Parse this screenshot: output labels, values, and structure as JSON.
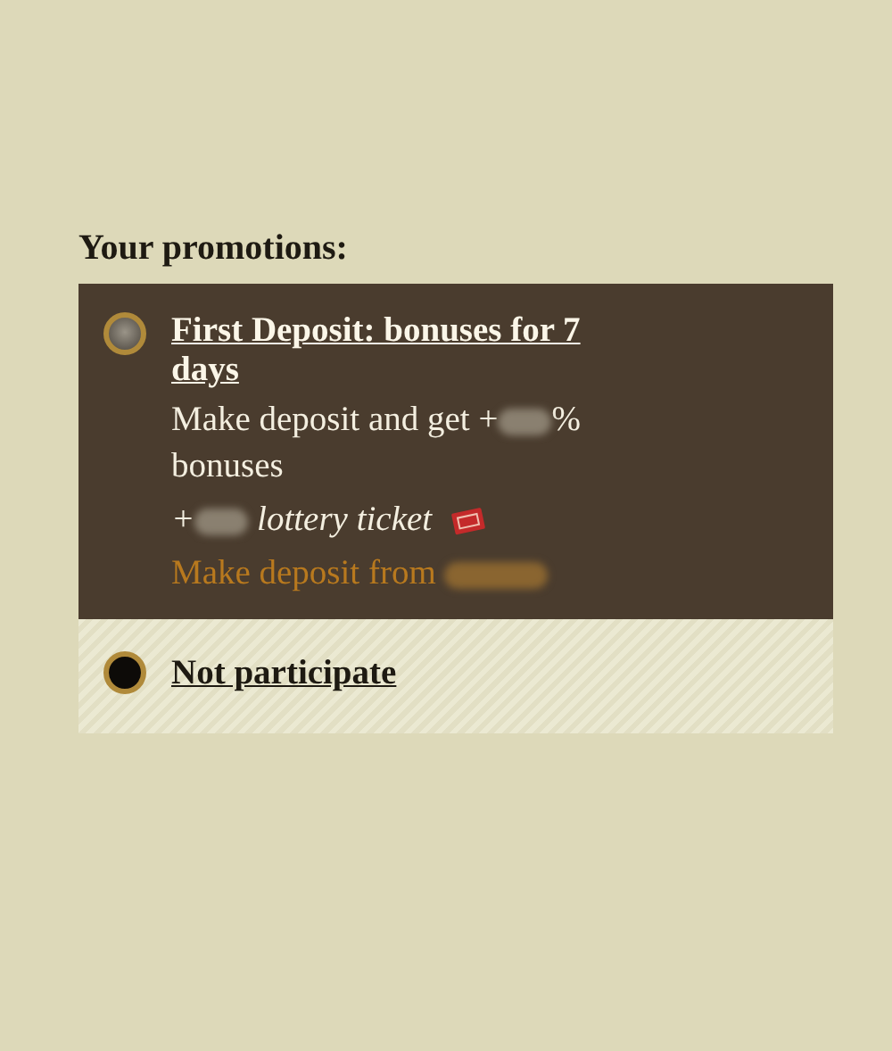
{
  "heading": "Your promotions:",
  "options": [
    {
      "kind": "promo",
      "selected": true,
      "title": "First Deposit: bonuses for 7 days",
      "offer": {
        "before": "Make deposit and get +",
        "after": "% bonuses"
      },
      "lottery": {
        "before": "+",
        "after": " lottery ticket"
      },
      "minimum": {
        "before": "Make deposit from"
      }
    },
    {
      "kind": "none",
      "selected": false,
      "title": "Not participate"
    }
  ]
}
